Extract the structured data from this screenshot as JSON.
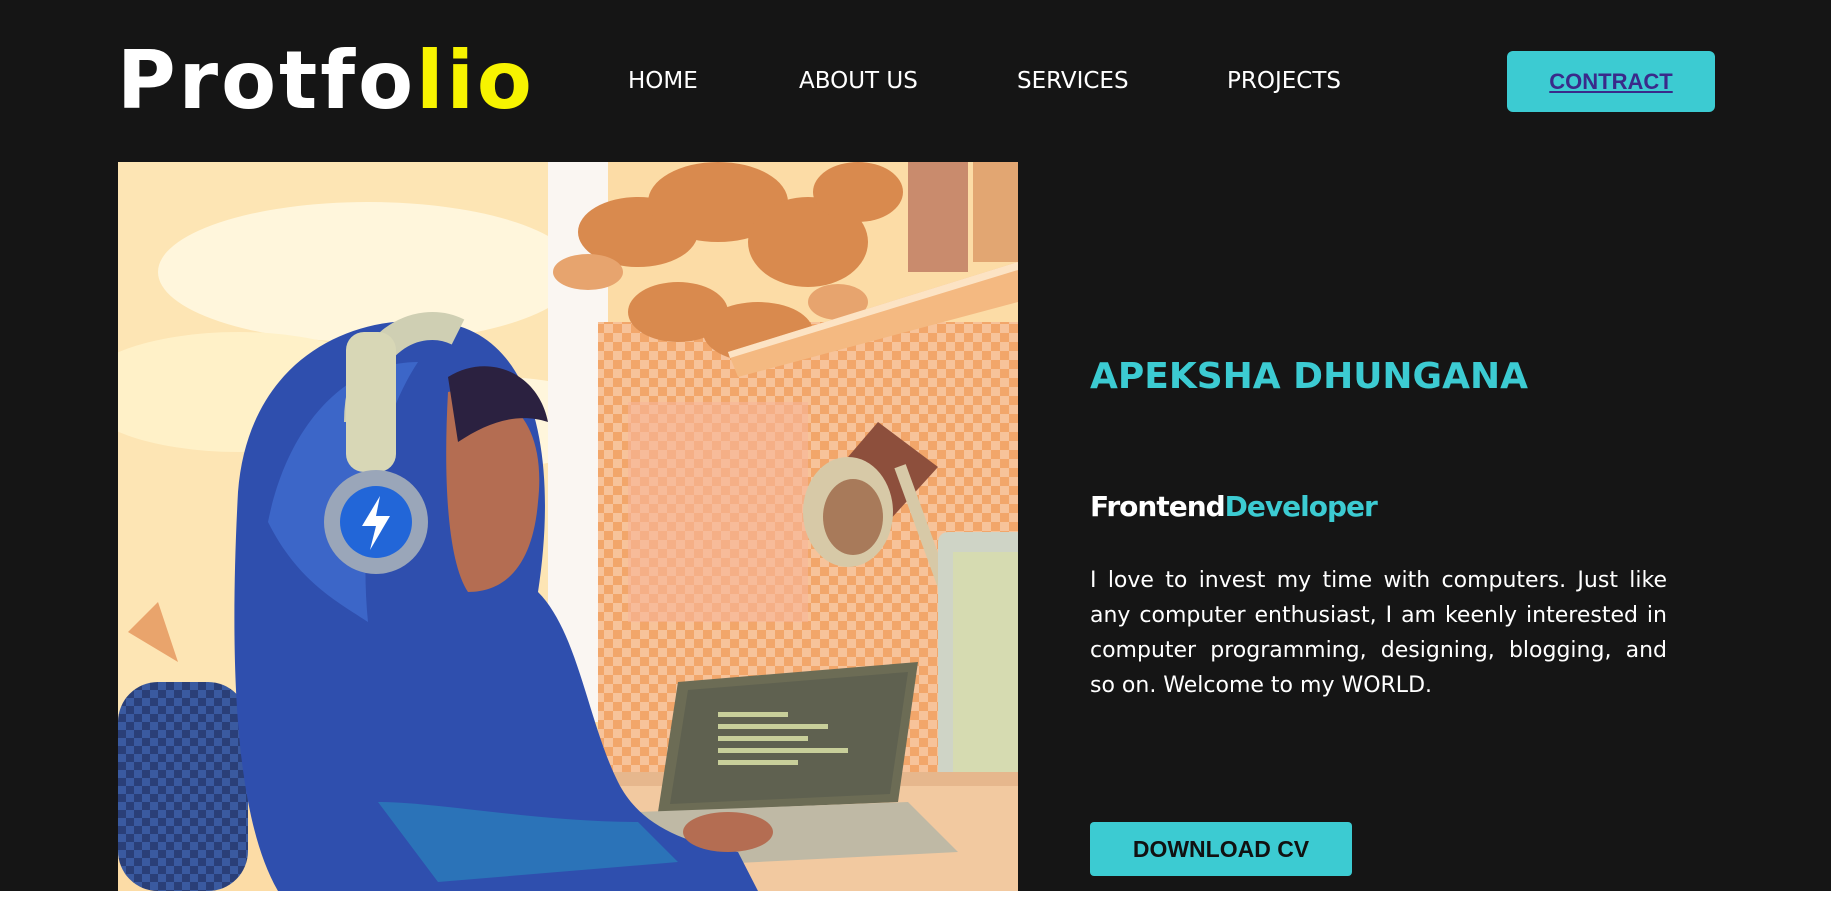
{
  "brand": {
    "logo_main": "Protfo",
    "logo_accent": "lio"
  },
  "nav": {
    "items": [
      {
        "label": "HOME"
      },
      {
        "label": "ABOUT US"
      },
      {
        "label": "SERVICES"
      },
      {
        "label": "PROJECTS"
      }
    ],
    "cta_label": "CONTRACT"
  },
  "hero": {
    "name": "APEKSHA DHUNGANA",
    "role_part1": "Frontend",
    "role_part2": "Developer",
    "description": "I love to invest my time with computers. Just like any computer enthusiast, I am keenly interested in computer programming, designing, blogging, and so on. Welcome to my WORLD.",
    "download_label": "DOWNLOAD CV",
    "image_icon": "illustration-person-with-headphones-at-laptop"
  },
  "colors": {
    "background": "#151515",
    "accent": "#3ccbd2",
    "logo_accent": "#f7f300",
    "text": "#ffffff"
  }
}
